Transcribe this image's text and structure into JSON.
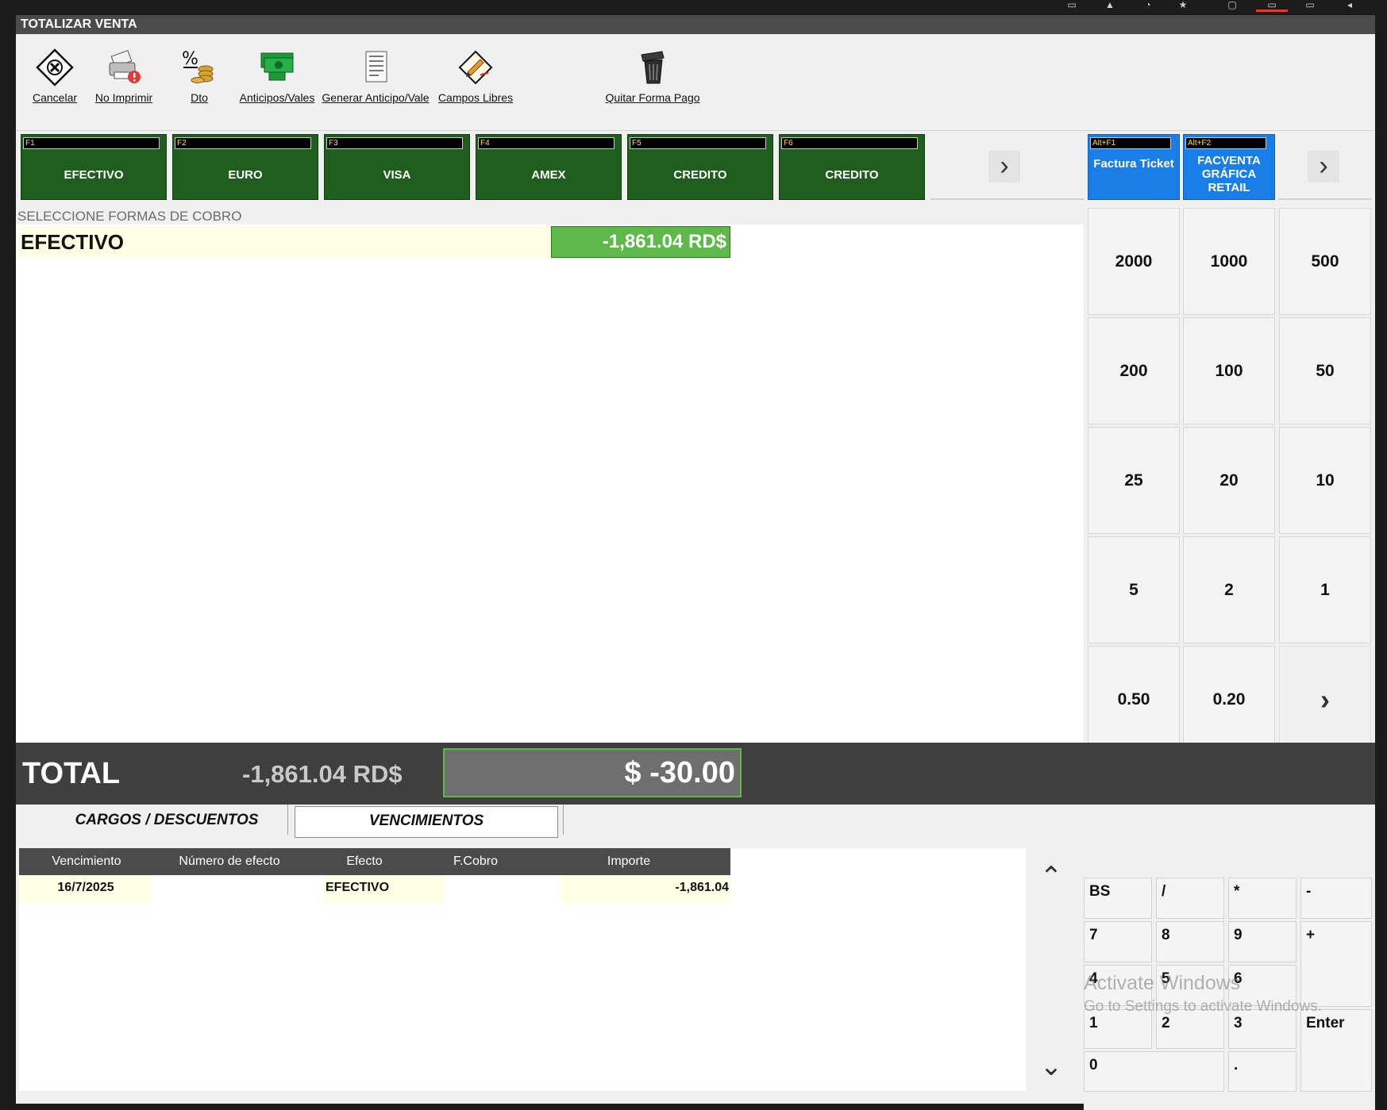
{
  "window": {
    "title": "TOTALIZAR VENTA"
  },
  "toolbar": {
    "items": [
      {
        "label": "Cancelar",
        "icon": "cancel-icon"
      },
      {
        "label": "No Imprimir",
        "icon": "printer-icon"
      },
      {
        "label": "Dto",
        "icon": "discount-icon"
      },
      {
        "label": "Anticipos/Vales",
        "icon": "banknotes-icon"
      },
      {
        "label": "Generar Anticipo/Vale",
        "icon": "receipt-icon"
      },
      {
        "label": "Campos Libres",
        "icon": "pen-paper-icon"
      },
      {
        "label": "Quitar Forma Pago",
        "icon": "trash-icon"
      }
    ]
  },
  "payment_methods": [
    {
      "key": "F1",
      "label": "EFECTIVO"
    },
    {
      "key": "F2",
      "label": "EURO"
    },
    {
      "key": "F3",
      "label": "VISA"
    },
    {
      "key": "F4",
      "label": "AMEX"
    },
    {
      "key": "F5",
      "label": "CREDITO"
    },
    {
      "key": "F6",
      "label": "CREDITO"
    }
  ],
  "documents": [
    {
      "key": "Alt+F1",
      "label": "Factura Ticket"
    },
    {
      "key": "Alt+F2",
      "label": "FACVENTA GRÁFICA RETAIL"
    }
  ],
  "selection": {
    "header": "SELECCIONE FORMAS DE COBRO",
    "line_name": "EFECTIVO",
    "line_amount": "-1,861.04 RD$"
  },
  "denominations": [
    "2000",
    "1000",
    "500",
    "200",
    "100",
    "50",
    "25",
    "20",
    "10",
    "5",
    "2",
    "1",
    "0.50",
    "0.20"
  ],
  "total": {
    "label": "TOTAL",
    "value": "-1,861.04 RD$",
    "box": "$ -30.00"
  },
  "tabs": [
    {
      "label": "CARGOS / DESCUENTOS",
      "active": false
    },
    {
      "label": "VENCIMIENTOS",
      "active": true
    }
  ],
  "table": {
    "columns": [
      "Vencimiento",
      "Número de efecto",
      "Efecto",
      "F.Cobro",
      "Importe"
    ],
    "rows": [
      [
        "16/7/2025",
        "",
        "EFECTIVO",
        "",
        "-1,861.04"
      ]
    ]
  },
  "numpad": {
    "keys": [
      "BS",
      "/",
      "*",
      "-",
      "7",
      "8",
      "9",
      "+",
      "4",
      "5",
      "6",
      "1",
      "2",
      "3",
      "Enter",
      "0",
      "."
    ]
  },
  "watermark": {
    "line1": "Activate Windows",
    "line2": "Go to Settings to activate Windows."
  },
  "colors": {
    "payment_green": "#1f5e1f",
    "document_blue": "#1a7ee8",
    "amount_green": "#5fb84a",
    "title_bar": "#4b4b4b"
  }
}
